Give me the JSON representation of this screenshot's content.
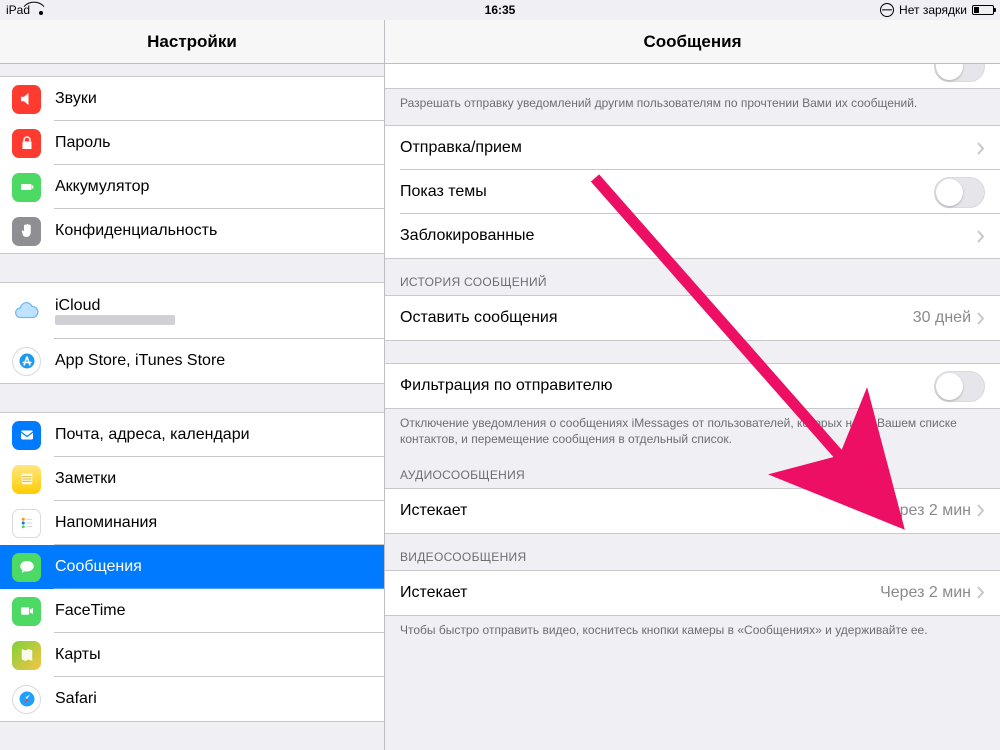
{
  "status": {
    "device": "iPad",
    "time": "16:35",
    "power": "Нет зарядки"
  },
  "sidebar": {
    "title": "Настройки",
    "g1": [
      {
        "label": "Звуки",
        "icon": "sound"
      },
      {
        "label": "Пароль",
        "icon": "lock"
      },
      {
        "label": "Аккумулятор",
        "icon": "battery"
      },
      {
        "label": "Конфиденциальность",
        "icon": "hand"
      }
    ],
    "g2": [
      {
        "label": "iCloud",
        "sub": "",
        "icon": "icloud"
      },
      {
        "label": "App Store, iTunes Store",
        "icon": "appstore"
      }
    ],
    "g3": [
      {
        "label": "Почта, адреса, календари",
        "icon": "mail"
      },
      {
        "label": "Заметки",
        "icon": "notes"
      },
      {
        "label": "Напоминания",
        "icon": "reminders"
      },
      {
        "label": "Сообщения",
        "icon": "messages",
        "selected": true
      },
      {
        "label": "FaceTime",
        "icon": "facetime"
      },
      {
        "label": "Карты",
        "icon": "maps"
      },
      {
        "label": "Safari",
        "icon": "safari"
      }
    ]
  },
  "detail": {
    "title": "Сообщения",
    "readFooter": "Разрешать отправку уведомлений другим пользователям по прочтении Вами их сообщений.",
    "sendReceive": "Отправка/прием",
    "showSubject": "Показ темы",
    "blocked": "Заблокированные",
    "historyHeader": "ИСТОРИЯ СООБЩЕНИЙ",
    "keepMessages": "Оставить сообщения",
    "keepMessagesValue": "30 дней",
    "filterSender": "Фильтрация по отправителю",
    "filterFooter": "Отключение уведомления о сообщениях iMessages от пользователей, которых нет в Вашем списке контактов, и перемещение сообщения  в отдельный список.",
    "audioHeader": "АУДИОСООБЩЕНИЯ",
    "expires": "Истекает",
    "audioValue": "Через 2 мин",
    "videoHeader": "ВИДЕОСООБЩЕНИЯ",
    "videoValue": "Через 2 мин",
    "videoFooter": "Чтобы быстро отправить видео, коснитесь кнопки камеры в «Сообщениях» и удерживайте ее."
  }
}
